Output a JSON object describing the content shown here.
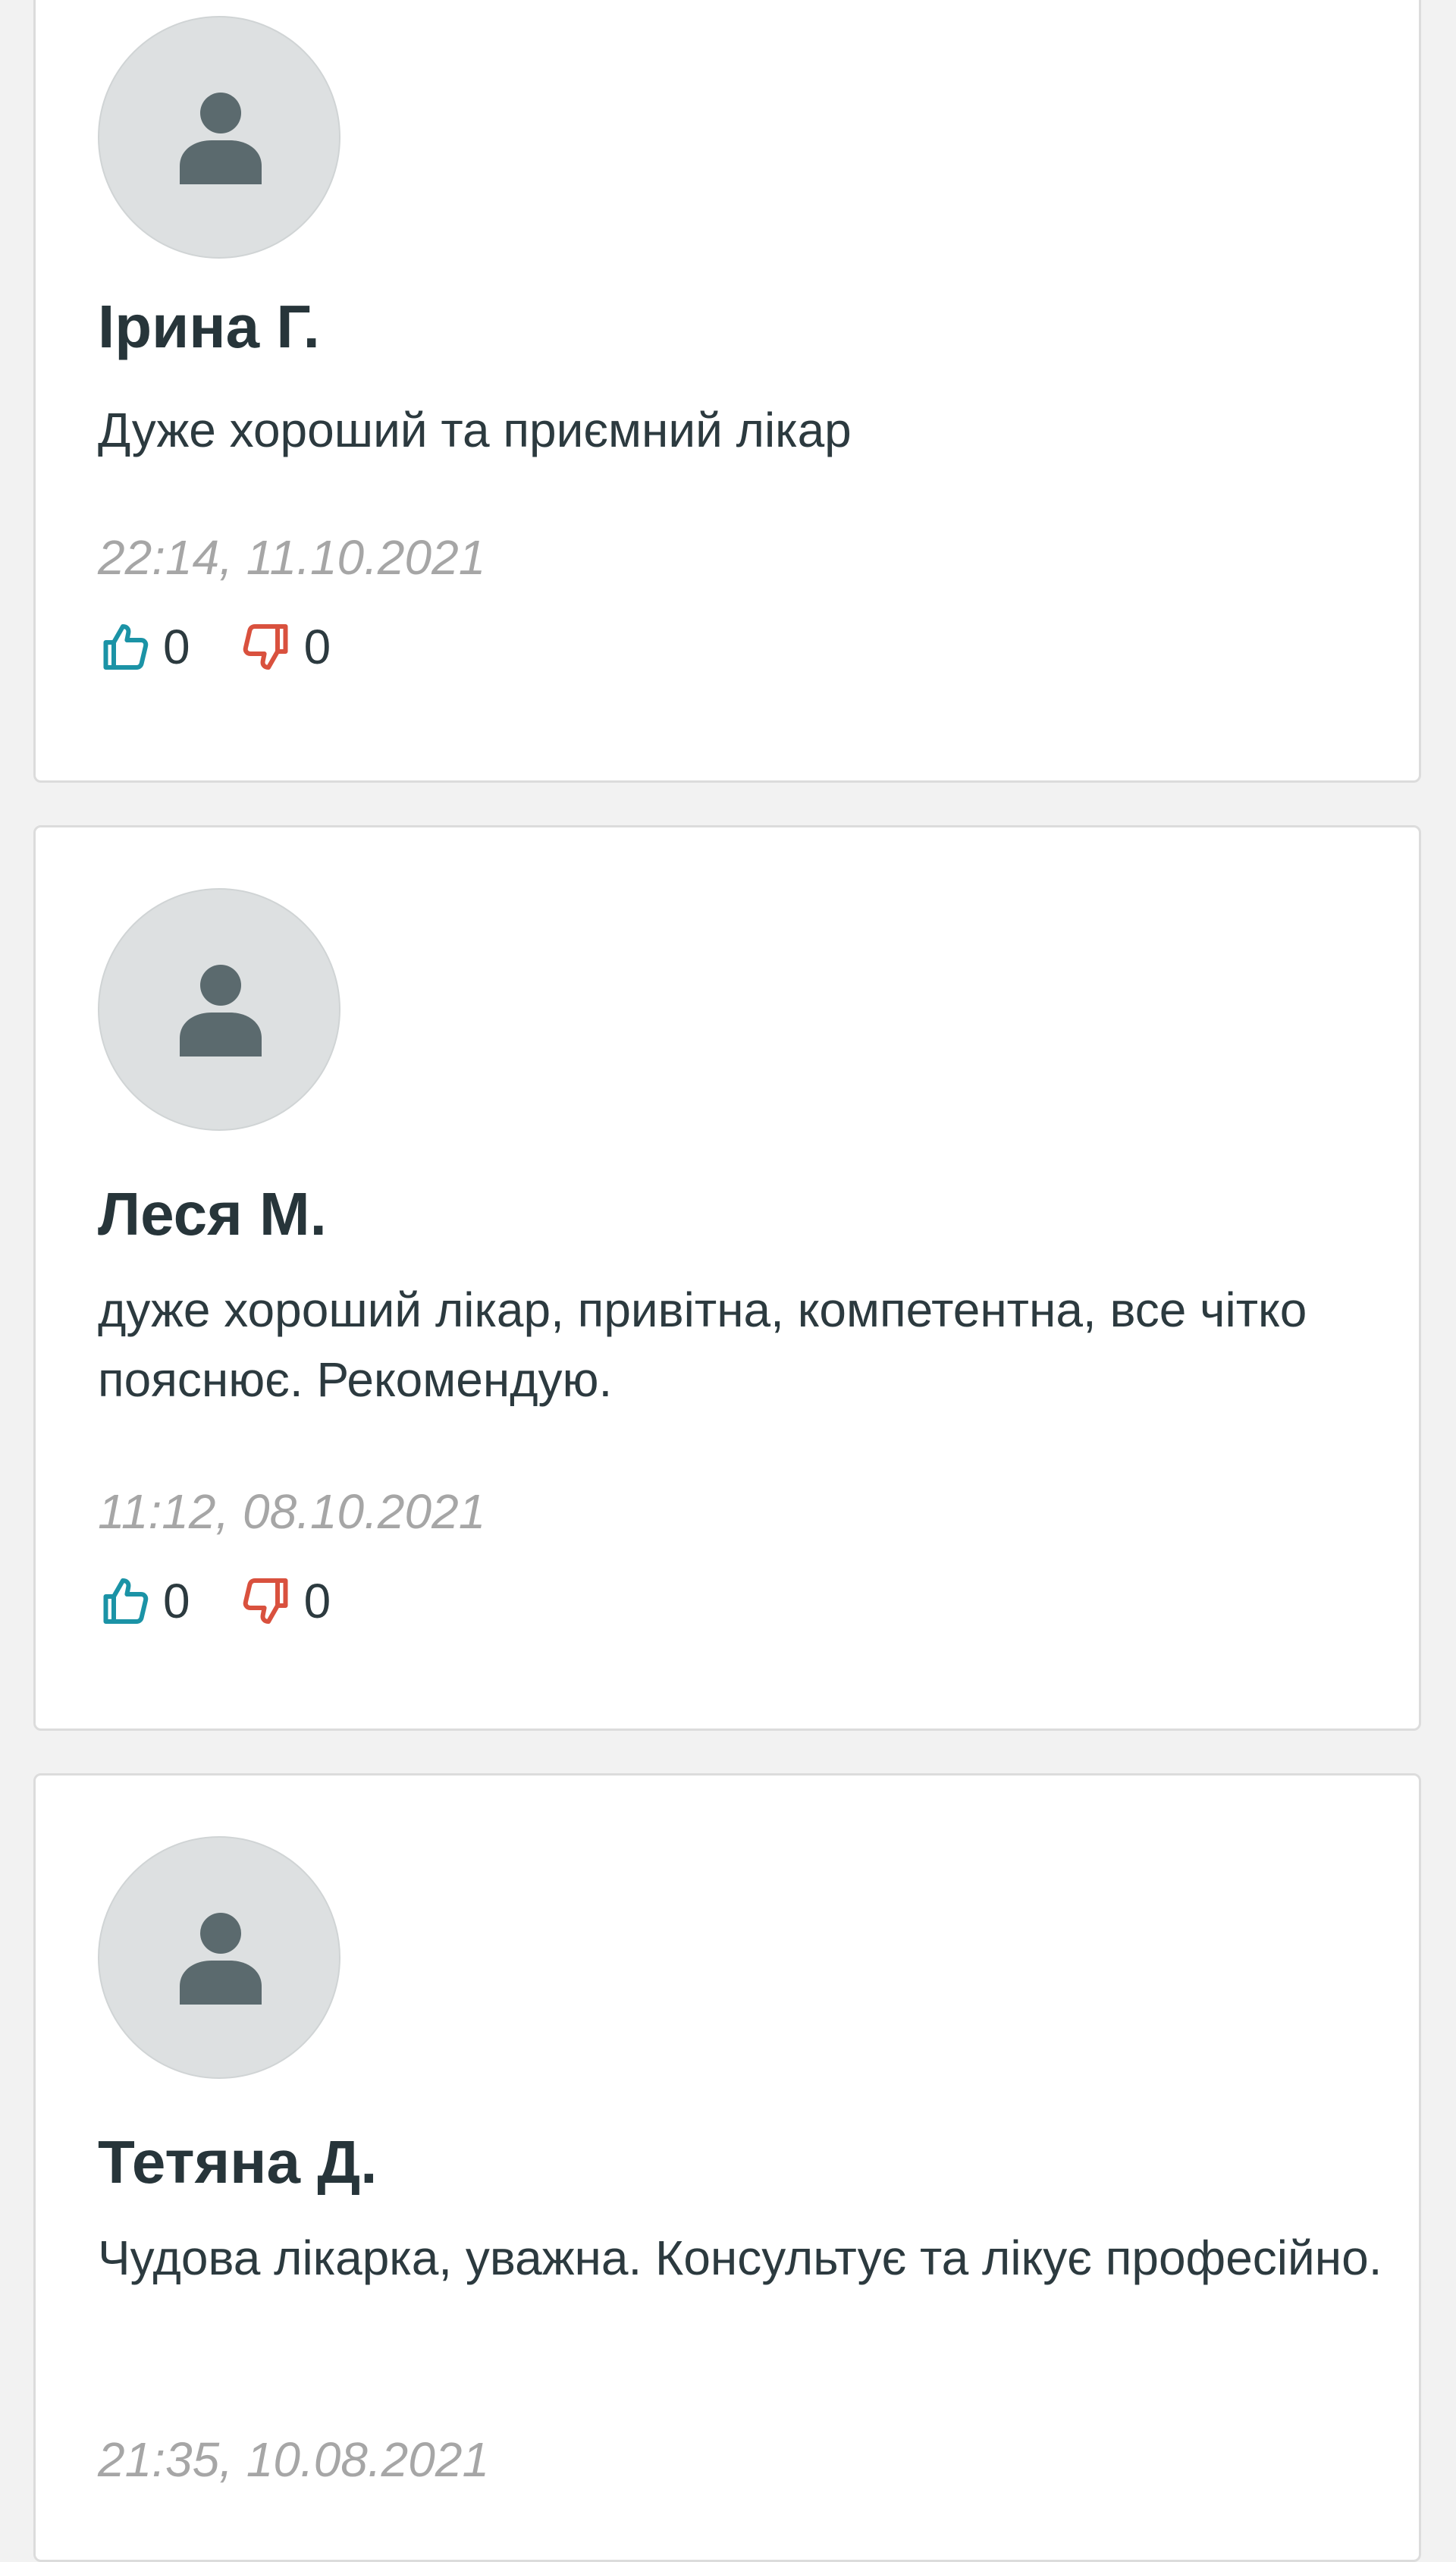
{
  "reviews": [
    {
      "name": "Ірина Г.",
      "text": "Дуже хороший та приємний лікар",
      "datetime": "22:14, 11.10.2021",
      "likes": "0",
      "dislikes": "0"
    },
    {
      "name": "Леся М.",
      "text": "дуже хороший лікар, привітна, компетентна, все чітко пояснює. Рекомендую.",
      "datetime": "11:12, 08.10.2021",
      "likes": "0",
      "dislikes": "0"
    },
    {
      "name": "Тетяна Д.",
      "text": "Чудова лікарка, уважна. Консультує та лікує професійно.",
      "datetime": "21:35, 10.08.2021"
    }
  ],
  "icons": {
    "avatar": "user-silhouette-icon",
    "like": "thumbs-up-icon",
    "dislike": "thumbs-down-icon"
  },
  "colors": {
    "like": "#1b93a6",
    "dislike": "#d9513e",
    "avatar_bg": "#dde0e1",
    "avatar_figure": "#5b6a6e",
    "date": "#a6a6a6"
  }
}
